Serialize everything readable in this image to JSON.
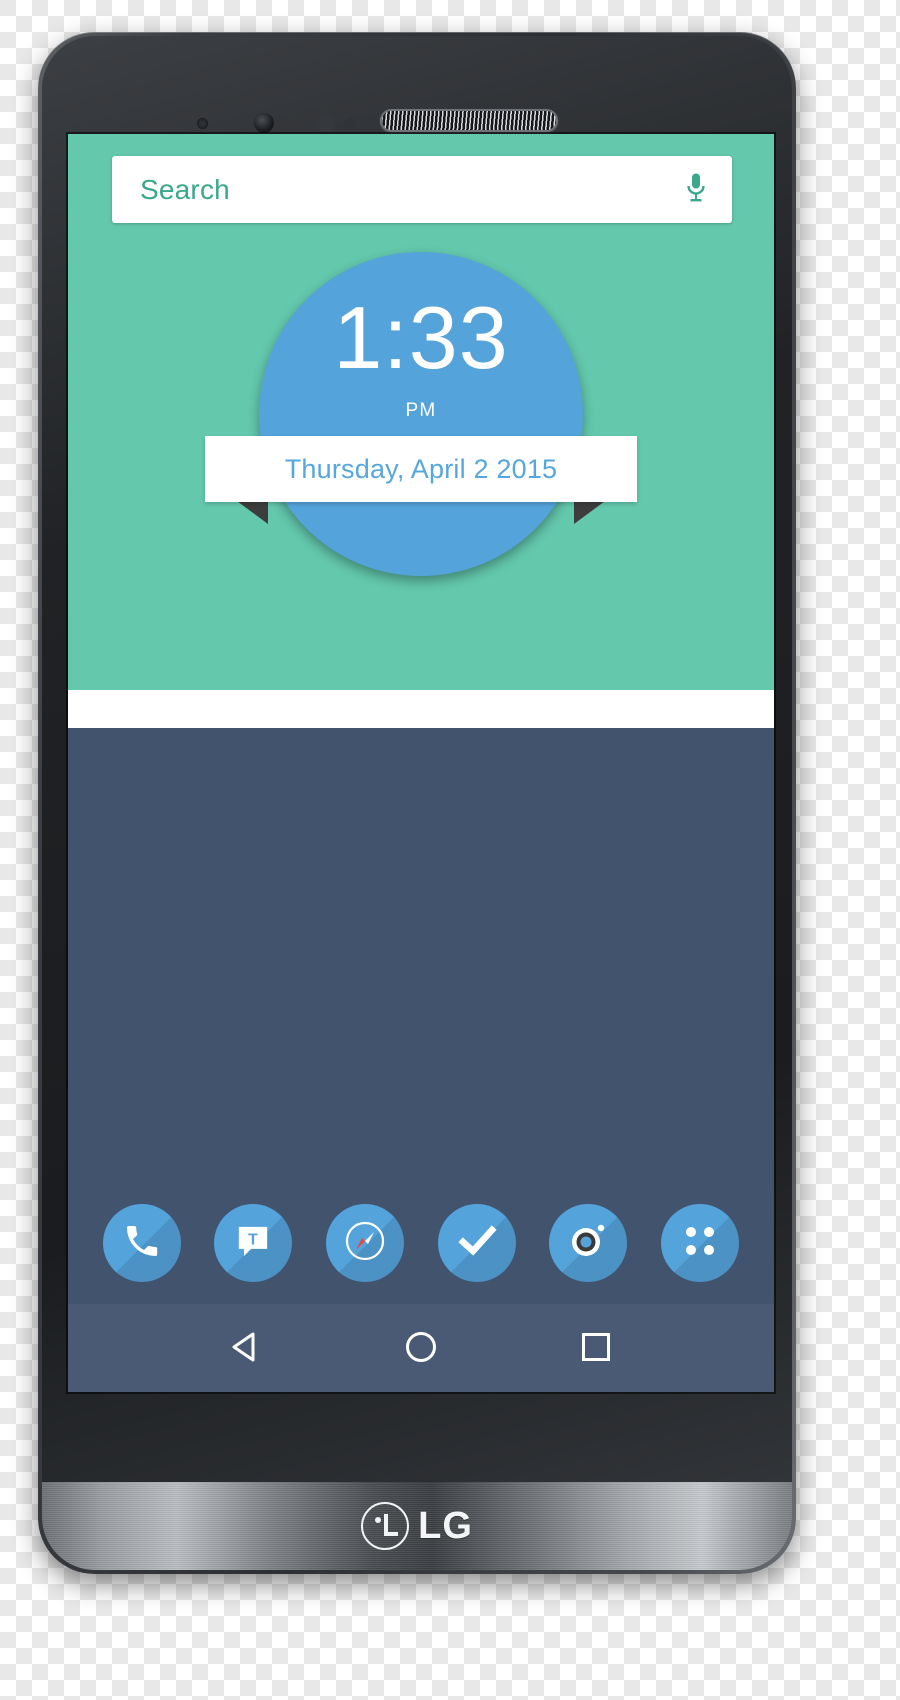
{
  "device": {
    "brand": "LG",
    "hardware": {
      "earpiece": "earpiece-speaker",
      "front_camera": "front-camera",
      "proximity_sensor": "proximity-sensor",
      "light_sensor": "light-sensor",
      "led_indicator": "led-indicator"
    }
  },
  "colors": {
    "wallpaper_green": "#63c8ac",
    "wallpaper_dark": "#42536e",
    "clock_blue": "#54a3da",
    "search_text": "#3aa88c",
    "date_text": "#56a7de",
    "nav_bar": "#4a5a74",
    "white": "#ffffff"
  },
  "search": {
    "placeholder": "Search",
    "value": "",
    "mic_icon": "microphone-icon"
  },
  "clock_widget": {
    "time": "1:33",
    "meridiem": "PM",
    "date": "Thursday, April 2 2015"
  },
  "dock": {
    "items": [
      {
        "name": "phone",
        "icon": "phone-icon",
        "label": "Phone"
      },
      {
        "name": "messaging",
        "icon": "message-t-icon",
        "label": "Messaging"
      },
      {
        "name": "browser",
        "icon": "compass-icon",
        "label": "Browser"
      },
      {
        "name": "tasks",
        "icon": "checkmark-icon",
        "label": "Tasks"
      },
      {
        "name": "camera",
        "icon": "camera-lens-icon",
        "label": "Camera"
      },
      {
        "name": "app-drawer",
        "icon": "app-drawer-icon",
        "label": "Apps"
      }
    ]
  },
  "nav_bar": {
    "buttons": [
      {
        "name": "back",
        "icon": "back-triangle-icon",
        "label": "Back"
      },
      {
        "name": "home",
        "icon": "home-circle-icon",
        "label": "Home"
      },
      {
        "name": "recents",
        "icon": "recents-square-icon",
        "label": "Recent apps"
      }
    ]
  }
}
